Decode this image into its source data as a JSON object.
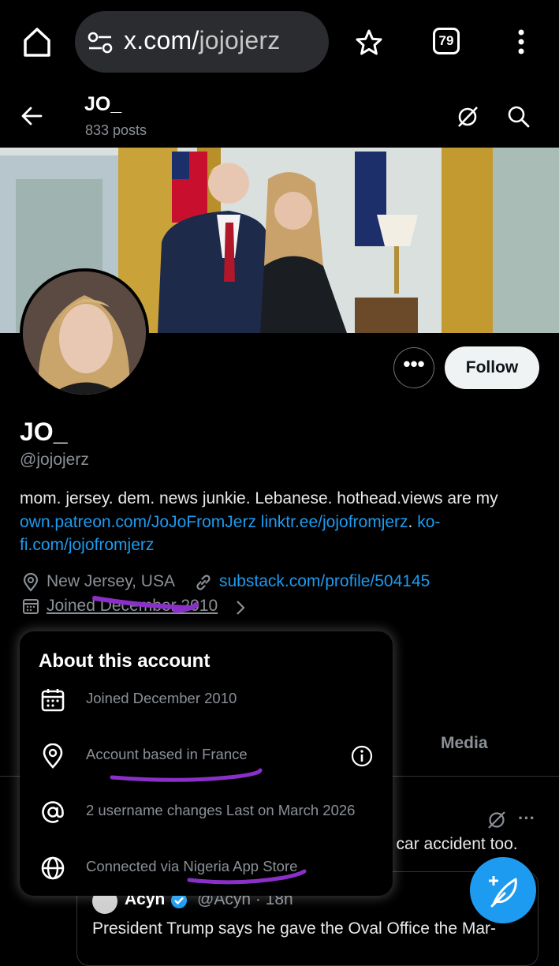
{
  "browser": {
    "url_domain": "x.com/",
    "url_path": "jojojerz",
    "tab_count": "79",
    "icons": [
      "home-icon",
      "site-settings-icon",
      "star-icon",
      "tabs-icon",
      "menu-dots-icon"
    ]
  },
  "header": {
    "title": "JO_",
    "post_count": "833 posts"
  },
  "profile": {
    "name": "JO_",
    "handle": "@jojojerz",
    "follow_label": "Follow",
    "more_label": "•••",
    "bio_text": "mom. jersey. dem. news junkie. Lebanese. hothead.views are my ",
    "bio_link1": "own.patreon.com/JoJoFromJerz",
    "bio_space": " ",
    "bio_link2": "linktr.ee/jojofromjerz",
    "bio_dot": ". ",
    "bio_link3": "ko-fi.com/jojofromjerz",
    "location": "New Jersey, USA",
    "website": "substack.com/profile/504145",
    "joined": "Joined December 2010"
  },
  "about_popup": {
    "title": "About this account",
    "rows": [
      {
        "icon": "calendar-icon",
        "text": "Joined December 2010"
      },
      {
        "icon": "location-icon",
        "text": "Account based in France"
      },
      {
        "icon": "at-sign-icon",
        "text": "2 username changes Last on March 2026"
      },
      {
        "icon": "globe-icon",
        "text": "Connected via Nigeria App Store"
      }
    ]
  },
  "tabs": {
    "media": "Media"
  },
  "feed": {
    "tweet_fragment": "d car accident too.",
    "more_label": "···",
    "quote_author": "Acyn",
    "quote_handle": "@Acyn · 18h",
    "quote_text": "President Trump says he gave the Oval Office the Mar-"
  },
  "colors": {
    "accent": "#1d9bf0",
    "annotation": "#8b2fc9",
    "muted_text": "#8b9096"
  }
}
